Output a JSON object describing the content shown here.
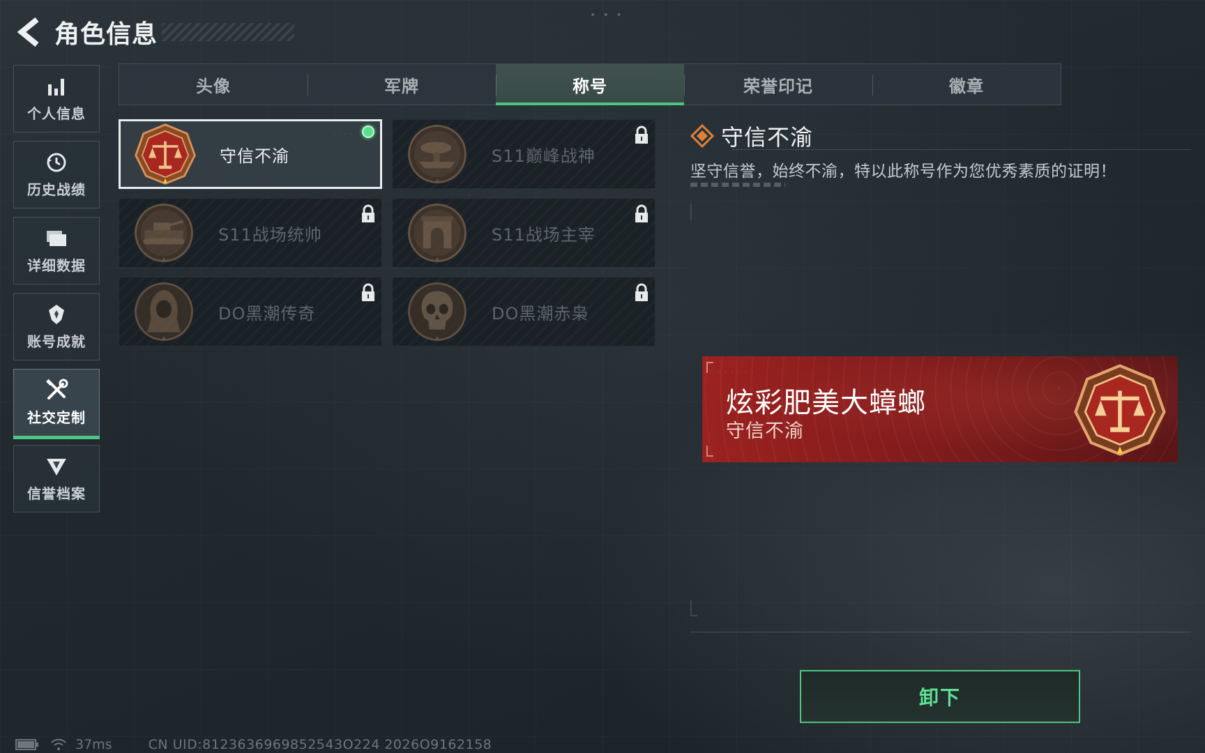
{
  "header": {
    "title": "角色信息",
    "back_icon": "back-arrow-icon"
  },
  "sidebar": {
    "items": [
      {
        "label": "个人信息",
        "icon": "bar-chart-icon",
        "active": false
      },
      {
        "label": "历史战绩",
        "icon": "history-clock-icon",
        "active": false
      },
      {
        "label": "详细数据",
        "icon": "folder-icon",
        "active": false
      },
      {
        "label": "账号成就",
        "icon": "achievement-badge-icon",
        "active": false
      },
      {
        "label": "社交定制",
        "icon": "tools-icon",
        "active": true
      },
      {
        "label": "信誉档案",
        "icon": "credit-shield-icon",
        "active": false
      }
    ]
  },
  "tabs": [
    {
      "label": "头像",
      "active": false
    },
    {
      "label": "军牌",
      "active": false
    },
    {
      "label": "称号",
      "active": true
    },
    {
      "label": "荣誉印记",
      "active": false
    },
    {
      "label": "徽章",
      "active": false
    }
  ],
  "titles": [
    {
      "name": "守信不渝",
      "medal": "scales-medal-icon",
      "locked": false,
      "selected": true,
      "equipped": true
    },
    {
      "name": "S11巅峰战神",
      "medal": "airship-medal-icon",
      "locked": true,
      "selected": false,
      "equipped": false
    },
    {
      "name": "S11战场统帅",
      "medal": "tank-medal-icon",
      "locked": true,
      "selected": false,
      "equipped": false
    },
    {
      "name": "S11战场主宰",
      "medal": "arch-medal-icon",
      "locked": true,
      "selected": false,
      "equipped": false
    },
    {
      "name": "DO黑潮传奇",
      "medal": "hooded-figure-medal-icon",
      "locked": true,
      "selected": false,
      "equipped": false
    },
    {
      "name": "DO黑潮赤枭",
      "medal": "skull-medal-icon",
      "locked": true,
      "selected": false,
      "equipped": false
    }
  ],
  "detail": {
    "title": "守信不渝",
    "description": "坚守信誉，始终不渝，特以此称号作为您优秀素质的证明！"
  },
  "nameplate": {
    "player_name": "炫彩肥美大蟑螂",
    "title": "守信不渝"
  },
  "actions": {
    "unequip_label": "卸下"
  },
  "status": {
    "ping": "37ms",
    "uid": "CN UID:8123636969852543O224 2026O9162158"
  },
  "colors": {
    "accent_green": "#4fc483",
    "nameplate_red": "#9b2220",
    "medal_bronze": "#b06a3c"
  }
}
